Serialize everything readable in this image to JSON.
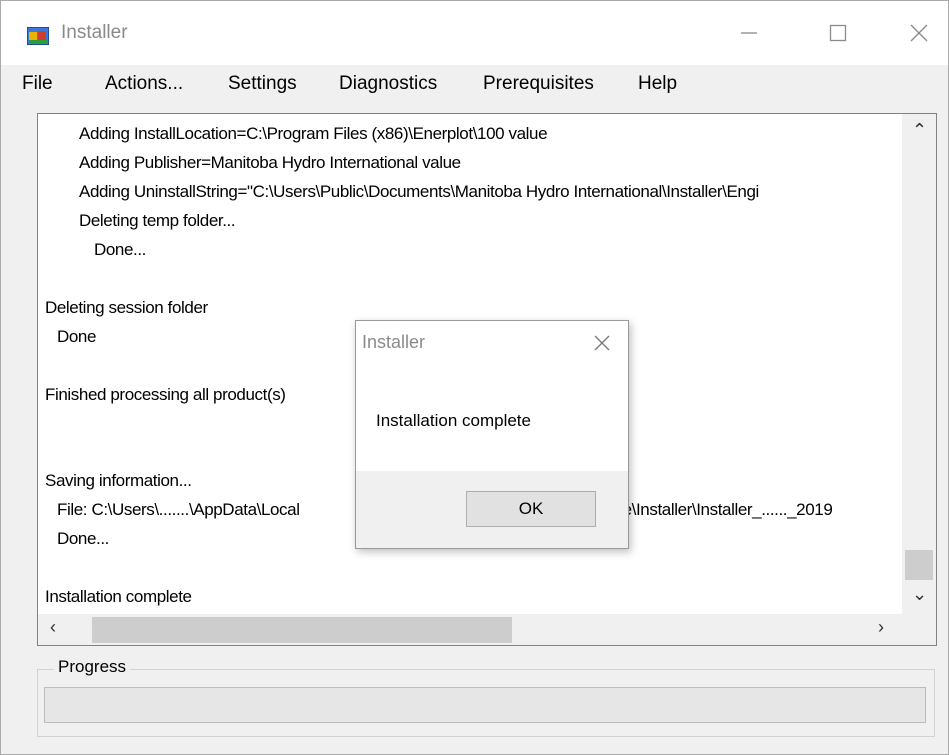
{
  "window": {
    "title": "Installer",
    "icons": {
      "app": "installer-app-icon",
      "minimize": "minimize-icon",
      "maximize": "maximize-icon",
      "close": "close-icon"
    }
  },
  "menu": [
    "File",
    "Actions...",
    "Settings",
    "Diagnostics",
    "Prerequisites",
    "Help"
  ],
  "log": {
    "lines": [
      "Adding InstallLocation=C:\\Program Files (x86)\\Enerplot\\100 value",
      "Adding Publisher=Manitoba Hydro International value",
      "Adding UninstallString=\"C:\\Users\\Public\\Documents\\Manitoba Hydro International\\Installer\\Engi",
      "Deleting temp folder...",
      "Done...",
      "",
      "Deleting session folder",
      "Done",
      "",
      "Finished processing all product(s)",
      "",
      "",
      "Saving information...",
      "File: C:\\Users\\.......\\AppData\\Local",
      "tre\\Installer\\Installer_......_2019",
      "Done...",
      "",
      "Installation complete"
    ]
  },
  "scrollbar_icons": {
    "up": "scroll-up-icon",
    "down": "scroll-down-icon",
    "left": "scroll-left-icon",
    "right": "scroll-right-icon"
  },
  "progress": {
    "label": "Progress",
    "value": 0
  },
  "dialog": {
    "title": "Installer",
    "message": "Installation complete",
    "ok_label": "OK",
    "close_icon": "close-icon"
  },
  "colors": {
    "window_bg": "#f0f0f0",
    "title_text": "#8a8a8a",
    "scroll_thumb": "#cdcdcd"
  }
}
